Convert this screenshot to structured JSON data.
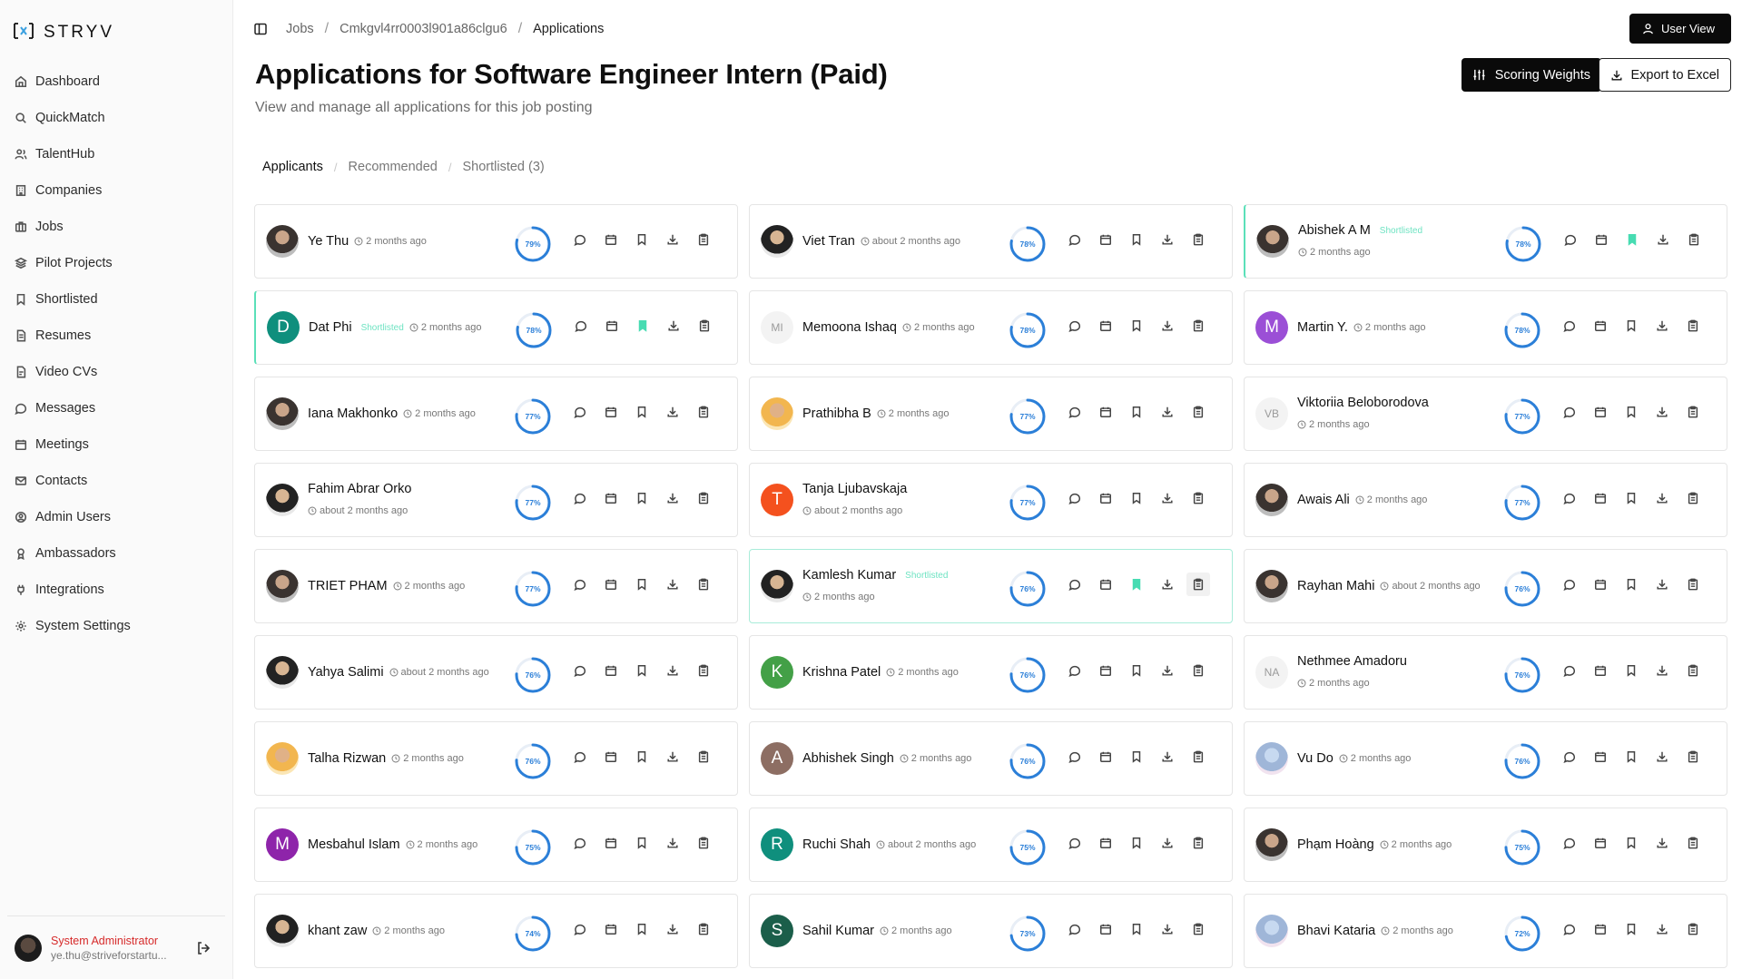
{
  "brand": {
    "name": "STRYV"
  },
  "sidebar": {
    "items": [
      {
        "label": "Dashboard",
        "icon": "home-icon"
      },
      {
        "label": "QuickMatch",
        "icon": "search-icon"
      },
      {
        "label": "TalentHub",
        "icon": "users-icon"
      },
      {
        "label": "Companies",
        "icon": "building-icon"
      },
      {
        "label": "Jobs",
        "icon": "briefcase-icon"
      },
      {
        "label": "Pilot Projects",
        "icon": "layers-icon"
      },
      {
        "label": "Shortlisted",
        "icon": "bookmark-icon"
      },
      {
        "label": "Resumes",
        "icon": "file-icon"
      },
      {
        "label": "Video CVs",
        "icon": "file-video-icon"
      },
      {
        "label": "Messages",
        "icon": "message-icon"
      },
      {
        "label": "Meetings",
        "icon": "calendar-icon"
      },
      {
        "label": "Contacts",
        "icon": "mail-icon"
      },
      {
        "label": "Admin Users",
        "icon": "user-circle-icon"
      },
      {
        "label": "Ambassadors",
        "icon": "award-icon"
      },
      {
        "label": "Integrations",
        "icon": "plug-icon"
      },
      {
        "label": "System Settings",
        "icon": "gear-icon"
      }
    ],
    "user": {
      "name": "System Administrator",
      "email": "ye.thu@striveforstartu..."
    }
  },
  "breadcrumb": {
    "jobs": "Jobs",
    "job_id": "Cmkgvl4rr0003l901a86clgu6",
    "current": "Applications"
  },
  "header": {
    "user_view": "User View",
    "title": "Applications for Software Engineer Intern (Paid)",
    "subtitle": "View and manage all applications for this job posting",
    "scoring_weights": "Scoring Weights",
    "export": "Export to Excel"
  },
  "tabs": [
    {
      "label": "Applicants",
      "active": true
    },
    {
      "label": "Recommended",
      "active": false
    },
    {
      "label": "Shortlisted (3)",
      "active": false
    }
  ],
  "accent_colors": {
    "shortlisted": "#5be0b9",
    "score_ring": "#2b7fd8",
    "admin_name": "#d62a2a"
  },
  "applicants": [
    {
      "name": "Ye Thu",
      "time": "2 months ago",
      "score": 79,
      "score_label": "79%",
      "avatar": "photo",
      "initial": "",
      "shortlisted": false,
      "badge": ""
    },
    {
      "name": "Viet Tran",
      "time": "about 2 months ago",
      "score": 78,
      "score_label": "78%",
      "avatar": "photo2",
      "initial": "",
      "shortlisted": false,
      "badge": ""
    },
    {
      "name": "Abishek A M",
      "time": "2 months ago",
      "score": 78,
      "score_label": "78%",
      "avatar": "photo",
      "initial": "",
      "shortlisted": true,
      "badge": "Shortlisted",
      "two_line": true
    },
    {
      "name": "Dat Phi",
      "time": "2 months ago",
      "score": 78,
      "score_label": "78%",
      "avatar": "#0f8f7d",
      "initial": "D",
      "shortlisted": true,
      "badge": "Shortlisted"
    },
    {
      "name": "Memoona Ishaq",
      "time": "2 months ago",
      "score": 78,
      "score_label": "78%",
      "avatar": "initials",
      "initial": "MI",
      "shortlisted": false,
      "badge": ""
    },
    {
      "name": "Martin Y.",
      "time": "2 months ago",
      "score": 78,
      "score_label": "78%",
      "avatar": "#9b4fd6",
      "initial": "M",
      "shortlisted": false,
      "badge": ""
    },
    {
      "name": "Iana Makhonko",
      "time": "2 months ago",
      "score": 77,
      "score_label": "77%",
      "avatar": "photo",
      "initial": "",
      "shortlisted": false,
      "badge": ""
    },
    {
      "name": "Prathibha B",
      "time": "2 months ago",
      "score": 77,
      "score_label": "77%",
      "avatar": "photo3",
      "initial": "",
      "shortlisted": false,
      "badge": ""
    },
    {
      "name": "Viktoriia Beloborodova",
      "time": "2 months ago",
      "score": 77,
      "score_label": "77%",
      "avatar": "initials",
      "initial": "VB",
      "shortlisted": false,
      "badge": "",
      "two_line": true
    },
    {
      "name": "Fahim Abrar Orko",
      "time": "about 2 months ago",
      "score": 77,
      "score_label": "77%",
      "avatar": "photo2",
      "initial": "",
      "shortlisted": false,
      "badge": "",
      "two_line": true
    },
    {
      "name": "Tanja Ljubavskaja",
      "time": "about 2 months ago",
      "score": 77,
      "score_label": "77%",
      "avatar": "#f4511e",
      "initial": "T",
      "shortlisted": false,
      "badge": "",
      "two_line": true
    },
    {
      "name": "Awais Ali",
      "time": "2 months ago",
      "score": 77,
      "score_label": "77%",
      "avatar": "photo",
      "initial": "",
      "shortlisted": false,
      "badge": ""
    },
    {
      "name": "TRIET PHAM",
      "time": "2 months ago",
      "score": 77,
      "score_label": "77%",
      "avatar": "photo",
      "initial": "",
      "shortlisted": false,
      "badge": ""
    },
    {
      "name": "Kamlesh Kumar",
      "time": "2 months ago",
      "score": 76,
      "score_label": "76%",
      "avatar": "photo2",
      "initial": "",
      "shortlisted": true,
      "badge": "Shortlisted",
      "two_line": true,
      "highlight": true
    },
    {
      "name": "Rayhan Mahi",
      "time": "about 2 months ago",
      "score": 76,
      "score_label": "76%",
      "avatar": "photo",
      "initial": "",
      "shortlisted": false,
      "badge": ""
    },
    {
      "name": "Yahya Salimi",
      "time": "about 2 months ago",
      "score": 76,
      "score_label": "76%",
      "avatar": "photo2",
      "initial": "",
      "shortlisted": false,
      "badge": ""
    },
    {
      "name": "Krishna Patel",
      "time": "2 months ago",
      "score": 76,
      "score_label": "76%",
      "avatar": "#43a047",
      "initial": "K",
      "shortlisted": false,
      "badge": ""
    },
    {
      "name": "Nethmee Amadoru",
      "time": "2 months ago",
      "score": 76,
      "score_label": "76%",
      "avatar": "initials",
      "initial": "NA",
      "shortlisted": false,
      "badge": "",
      "two_line": true
    },
    {
      "name": "Talha Rizwan",
      "time": "2 months ago",
      "score": 76,
      "score_label": "76%",
      "avatar": "photo3",
      "initial": "",
      "shortlisted": false,
      "badge": ""
    },
    {
      "name": "Abhishek Singh",
      "time": "2 months ago",
      "score": 76,
      "score_label": "76%",
      "avatar": "#8d6e63",
      "initial": "A",
      "shortlisted": false,
      "badge": ""
    },
    {
      "name": "Vu Do",
      "time": "2 months ago",
      "score": 76,
      "score_label": "76%",
      "avatar": "photo4",
      "initial": "",
      "shortlisted": false,
      "badge": ""
    },
    {
      "name": "Mesbahul Islam",
      "time": "2 months ago",
      "score": 75,
      "score_label": "75%",
      "avatar": "#8e24aa",
      "initial": "M",
      "shortlisted": false,
      "badge": ""
    },
    {
      "name": "Ruchi Shah",
      "time": "about 2 months ago",
      "score": 75,
      "score_label": "75%",
      "avatar": "#0f8f7d",
      "initial": "R",
      "shortlisted": false,
      "badge": ""
    },
    {
      "name": "Phạm Hoàng",
      "time": "2 months ago",
      "score": 75,
      "score_label": "75%",
      "avatar": "photo",
      "initial": "",
      "shortlisted": false,
      "badge": ""
    },
    {
      "name": "khant zaw",
      "time": "2 months ago",
      "score": 74,
      "score_label": "74%",
      "avatar": "photo2",
      "initial": "",
      "shortlisted": false,
      "badge": ""
    },
    {
      "name": "Sahil Kumar",
      "time": "2 months ago",
      "score": 73,
      "score_label": "73%",
      "avatar": "#1b5e4a",
      "initial": "S",
      "shortlisted": false,
      "badge": ""
    },
    {
      "name": "Bhavi Kataria",
      "time": "2 months ago",
      "score": 72,
      "score_label": "72%",
      "avatar": "photo4",
      "initial": "",
      "shortlisted": false,
      "badge": ""
    }
  ]
}
